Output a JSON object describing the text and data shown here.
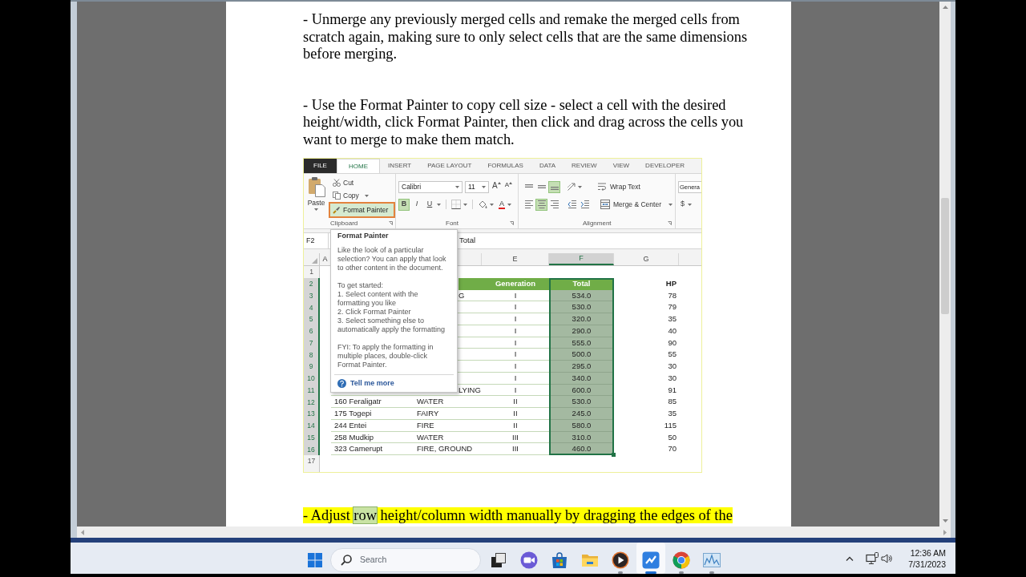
{
  "document": {
    "blocks": [
      {
        "kind": "paragraph",
        "highlighted": false,
        "segments": [
          {
            "text": "- Unmerge any previously merged cells and remake the merged cells from scratch again, making sure to only select cells that are the same dimensions before merging.",
            "marked": false
          }
        ]
      },
      {
        "kind": "paragraph",
        "highlighted": false,
        "segments": [
          {
            "text": "- Use the Format Painter to copy cell size - select a cell with the desired height/width, click Format Painter, then click and drag across the cells you want to merge to make them match.",
            "marked": false
          }
        ]
      },
      {
        "kind": "spreadsheet",
        "tabs": [
          {
            "label": "FILE",
            "kind": "backstage",
            "selected": false
          },
          {
            "label": "HOME",
            "kind": "tab",
            "selected": true
          },
          {
            "label": "INSERT",
            "kind": "tab",
            "selected": false
          },
          {
            "label": "PAGE LAYOUT",
            "kind": "tab",
            "selected": false
          },
          {
            "label": "FORMULAS",
            "kind": "tab",
            "selected": false
          },
          {
            "label": "DATA",
            "kind": "tab",
            "selected": false
          },
          {
            "label": "REVIEW",
            "kind": "tab",
            "selected": false
          },
          {
            "label": "VIEW",
            "kind": "tab",
            "selected": false
          },
          {
            "label": "DEVELOPER",
            "kind": "tab",
            "selected": false
          }
        ],
        "clipboard": {
          "paste": "Paste",
          "cut": "Cut",
          "copy": "Copy",
          "format_painter": {
            "label": "Format Painter",
            "highlighted": true
          },
          "label": "Clipboard"
        },
        "font": {
          "name": "Calibri",
          "size": "11",
          "size_buttons": [
            {
              "label": "A",
              "kind": "grow"
            },
            {
              "label": "A",
              "kind": "shrink"
            }
          ],
          "styles": [
            {
              "label": "B",
              "kind": "bold",
              "on": true
            },
            {
              "label": "I",
              "kind": "italic",
              "on": false
            },
            {
              "label": "U",
              "kind": "underline",
              "on": false
            }
          ],
          "font_color": "A",
          "label": "Font"
        },
        "alignment": {
          "vertical": [
            {
              "kind": "top",
              "on": false
            },
            {
              "kind": "middle",
              "on": false
            },
            {
              "kind": "bottom",
              "on": true
            }
          ],
          "horizontal": [
            {
              "kind": "left",
              "on": false
            },
            {
              "kind": "center",
              "on": true
            },
            {
              "kind": "right",
              "on": false
            }
          ],
          "wrap_text": "Wrap Text",
          "merge": "Merge & Center",
          "label": "Alignment"
        },
        "number": {
          "format": "Genera",
          "currency": "$"
        },
        "name_box": "F2",
        "formula": "Total",
        "columns": [
          {
            "label": "A",
            "selected": false
          },
          {
            "label": "E",
            "selected": false
          },
          {
            "label": "F",
            "selected": true
          },
          {
            "label": "G",
            "selected": false
          }
        ],
        "rows": [
          {
            "number": "1",
            "selected": false,
            "kind": "blank"
          },
          {
            "number": "2",
            "selected": true,
            "kind": "header",
            "generation": "Generation",
            "total": "Total",
            "hp": "HP"
          },
          {
            "number": "3",
            "selected": true,
            "kind": "data",
            "type": "G",
            "generation": "I",
            "total": "534.0",
            "hp": "78"
          },
          {
            "number": "4",
            "selected": true,
            "kind": "data",
            "generation": "I",
            "total": "530.0",
            "hp": "79"
          },
          {
            "number": "5",
            "selected": true,
            "kind": "data",
            "generation": "I",
            "total": "320.0",
            "hp": "35"
          },
          {
            "number": "6",
            "selected": true,
            "kind": "data",
            "generation": "I",
            "total": "290.0",
            "hp": "40"
          },
          {
            "number": "7",
            "selected": true,
            "kind": "data",
            "generation": "I",
            "total": "555.0",
            "hp": "90"
          },
          {
            "number": "8",
            "selected": true,
            "kind": "data",
            "generation": "I",
            "total": "500.0",
            "hp": "55"
          },
          {
            "number": "9",
            "selected": true,
            "kind": "data",
            "generation": "I",
            "total": "295.0",
            "hp": "30"
          },
          {
            "number": "10",
            "selected": true,
            "kind": "data",
            "generation": "I",
            "total": "340.0",
            "hp": "30"
          },
          {
            "number": "11",
            "selected": true,
            "kind": "data",
            "type": "LYING",
            "generation": "I",
            "total": "600.0",
            "hp": "91"
          },
          {
            "number": "12",
            "selected": true,
            "kind": "data",
            "name": "160 Feraligatr",
            "type": "WATER",
            "generation": "II",
            "total": "530.0",
            "hp": "85"
          },
          {
            "number": "13",
            "selected": true,
            "kind": "data",
            "name": "175 Togepi",
            "type": "FAIRY",
            "generation": "II",
            "total": "245.0",
            "hp": "35"
          },
          {
            "number": "14",
            "selected": true,
            "kind": "data",
            "name": "244 Entei",
            "type": "FIRE",
            "generation": "II",
            "total": "580.0",
            "hp": "115"
          },
          {
            "number": "15",
            "selected": true,
            "kind": "data",
            "name": "258 Mudkip",
            "type": "WATER",
            "generation": "III",
            "total": "310.0",
            "hp": "50"
          },
          {
            "number": "16",
            "selected": true,
            "kind": "data",
            "name": "323 Camerupt",
            "type": "FIRE, GROUND",
            "generation": "III",
            "total": "460.0",
            "hp": "70"
          },
          {
            "number": "17",
            "selected": false,
            "kind": "blank"
          }
        ],
        "tooltip": {
          "title": "Format Painter",
          "sections": [
            {
              "lines": [
                "Like the look of a particular selection? You can apply that look to other content in the document."
              ]
            },
            {
              "lines": [
                "To get started:",
                "1. Select content with the formatting you like",
                "2. Click Format Painter",
                "3. Select something else to automatically apply the formatting"
              ]
            },
            {
              "lines": [
                "FYI: To apply the formatting in multiple places, double-click Format Painter."
              ]
            }
          ],
          "link": "Tell me more"
        }
      },
      {
        "kind": "paragraph",
        "highlighted": true,
        "segments": [
          {
            "text": "- Adjust ",
            "marked": false
          },
          {
            "text": "row",
            "marked": true
          },
          {
            "text": " height/column width manually by dragging the edges of the",
            "marked": false
          }
        ]
      }
    ]
  },
  "taskbar": {
    "search": {
      "placeholder": "Search"
    },
    "apps": [
      {
        "kind": "taskview",
        "running": false,
        "active": false
      },
      {
        "kind": "chat",
        "running": false,
        "active": false
      },
      {
        "kind": "store",
        "running": false,
        "active": false
      },
      {
        "kind": "folder",
        "running": false,
        "active": false
      },
      {
        "kind": "player",
        "running": true,
        "active": false
      },
      {
        "kind": "zigzag",
        "running": true,
        "active": true
      },
      {
        "kind": "tricolor",
        "running": true,
        "active": false
      },
      {
        "kind": "graph",
        "running": true,
        "active": false
      }
    ],
    "clock": {
      "time": "12:36 AM",
      "date": "7/31/2023"
    }
  }
}
